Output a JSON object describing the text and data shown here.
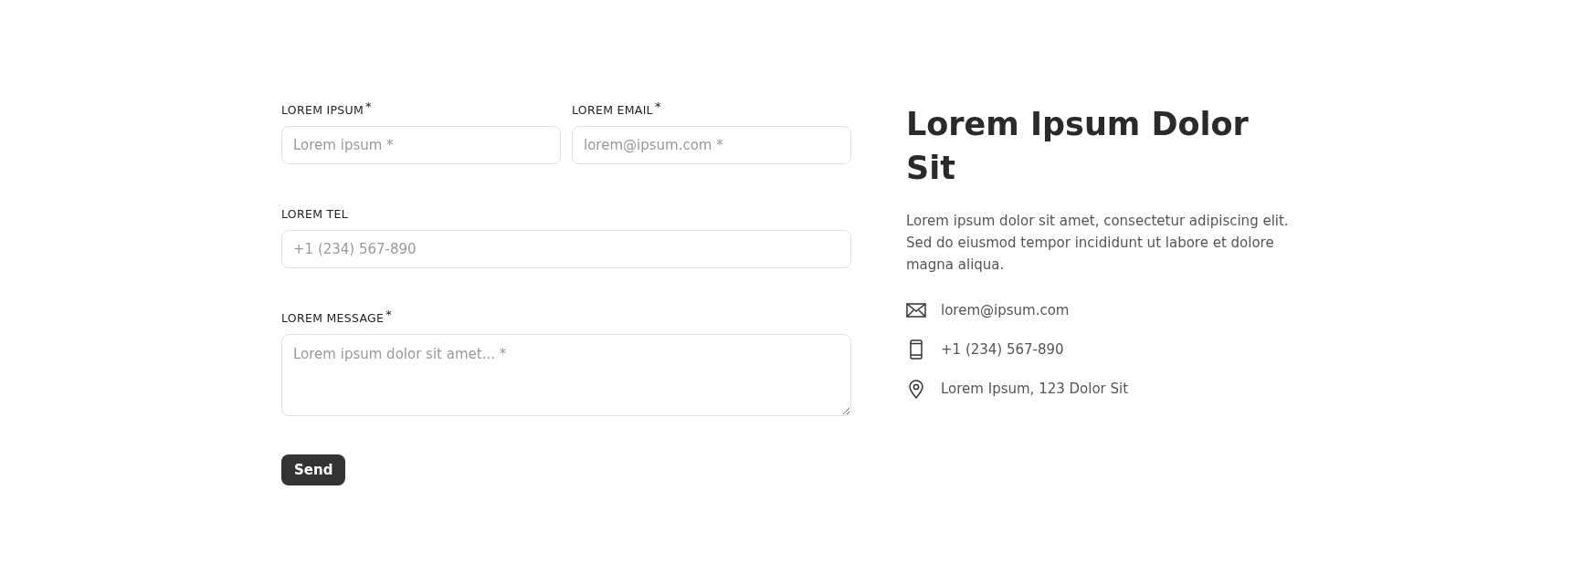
{
  "form": {
    "rows": [
      [
        {
          "kind": "input",
          "label": "LOREM IPSUM$^{*}$",
          "placeholder": "Lorem ipsum *"
        },
        {
          "kind": "input",
          "label": "LOREM EMAIL$^{*}$",
          "placeholder": "lorem@ipsum.com *"
        }
      ],
      [
        {
          "kind": "input",
          "label": "LOREM TEL",
          "placeholder": "+1 (234) 567-890"
        }
      ],
      [
        {
          "kind": "textarea",
          "label": "LOREM MESSAGE$^{*}$",
          "placeholder": "Lorem ipsum dolor sit amet... *"
        }
      ]
    ],
    "submit": "Send"
  },
  "info": {
    "title": "Lorem Ipsum Dolor Sit",
    "description": "Lorem ipsum dolor sit amet, consectetur adipiscing elit. Sed do eiusmod tempor incididunt ut labore et dolore magna aliqua.",
    "contacts": [
      {
        "kind": "email",
        "text": "lorem@ipsum.com"
      },
      {
        "kind": "phone",
        "text": "+1 (234) 567-890"
      },
      {
        "kind": "address",
        "text": "Lorem Ipsum, 123 Dolor Sit"
      }
    ]
  }
}
